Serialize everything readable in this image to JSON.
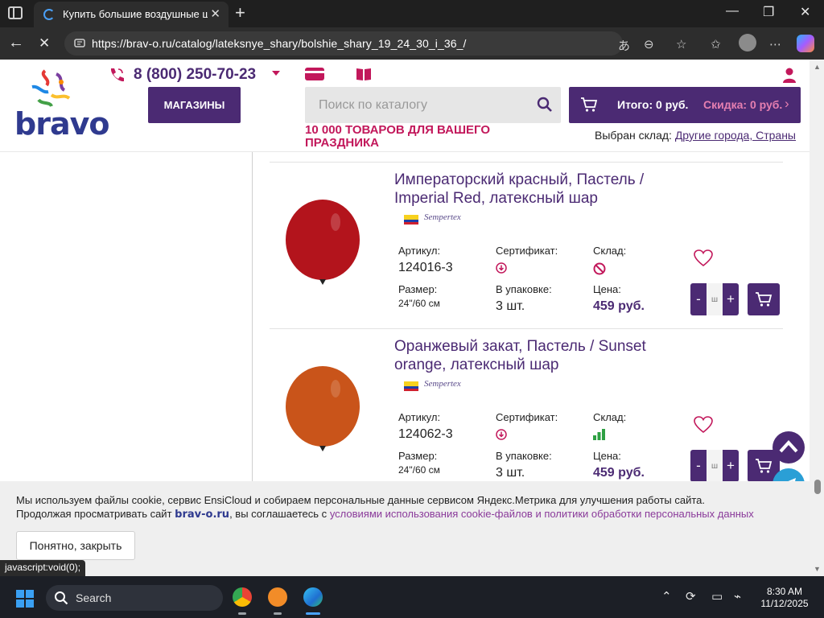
{
  "browser": {
    "tab_title": "Купить большие воздушные шар",
    "url": "https://brav-o.ru/catalog/lateksnye_shary/bolshie_shary_19_24_30_i_36_/",
    "status_text": "javascript:void(0);"
  },
  "header": {
    "logo_text": "bravo",
    "phone": "8 (800) 250-70-23",
    "stores_label": "МАГАЗИНЫ",
    "search_placeholder": "Поиск по каталогу",
    "cart_total": "Итого: 0 руб.",
    "cart_discount": "Скидка: 0 руб.",
    "tagline": "10 000 ТОВАРОВ ДЛЯ ВАШЕГО ПРАЗДНИКА",
    "warehouse_label": "Выбран склад:",
    "warehouse_link": "Другие города, Страны"
  },
  "labels": {
    "article": "Артикул:",
    "certificate": "Сертификат:",
    "stock": "Склад:",
    "size": "Размер:",
    "pack": "В упаковке:",
    "price": "Цена:"
  },
  "products": [
    {
      "name": "Императорский красный, Пастель / Imperial Red, латексный шар",
      "brand": "Sempertex",
      "article": "124016-3",
      "size": "24\"/60 см",
      "pack": "3 шт.",
      "price": "459 руб.",
      "qty_placeholder": "ш",
      "balloon_color": "#b3141c",
      "stock_state": "unavailable"
    },
    {
      "name": "Оранжевый закат, Пастель / Sunset orange, латексный шар",
      "brand": "Sempertex",
      "article": "124062-3",
      "size": "24\"/60 см",
      "pack": "3 шт.",
      "price": "459 руб.",
      "qty_placeholder": "ш",
      "balloon_color": "#c9541a",
      "stock_state": "available"
    }
  ],
  "cookie": {
    "line1": "Мы используем файлы cookie, сервис EnsiCloud и собираем персональные данные сервисом Яндекс.Метрика для улучшения работы сайта.",
    "line2_prefix": "Продолжая просматривать сайт",
    "line2_brand": "brav-o.ru",
    "line2_middle": ", вы соглашаетесь с",
    "line2_link": "условиями использования cookie-файлов и политики обработки персональных данных",
    "ok_label": "Понятно, закрыть"
  },
  "taskbar": {
    "search_label": "Search",
    "time": "8:30 AM",
    "date": "11/12/2025"
  },
  "colors": {
    "brand_purple": "#4b2a73",
    "brand_pink": "#c2185b",
    "stock_green": "#2ea043"
  }
}
